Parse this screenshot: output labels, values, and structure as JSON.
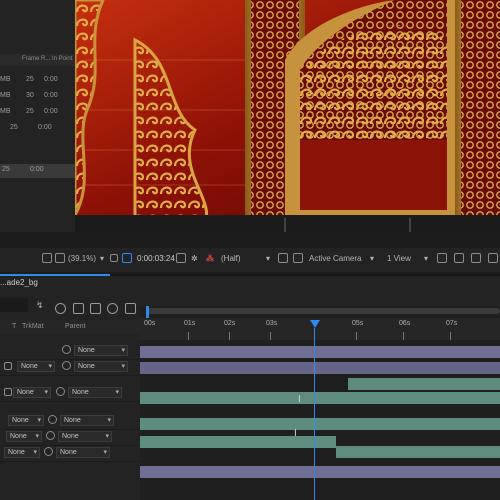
{
  "project": {
    "columns": {
      "frame_rate": "Frame R...",
      "in_point": "In Point"
    },
    "rows": [
      {
        "size": "MB",
        "frame_rate": "25",
        "in_point": "0:00"
      },
      {
        "size": "MB",
        "frame_rate": "30",
        "in_point": "0:00"
      },
      {
        "size": "MB",
        "frame_rate": "25",
        "in_point": "0:00"
      },
      {
        "size": "",
        "frame_rate": "25",
        "in_point": "0:00"
      },
      {
        "size": "",
        "frame_rate": "25",
        "in_point": "0:00"
      }
    ]
  },
  "viewer_toolbar": {
    "zoom": "(39.1%)",
    "timecode": "0:00:03:24",
    "resolution": "(Half)",
    "camera": "Active Camera",
    "view": "1 View"
  },
  "timeline": {
    "tab_name": "...ade2_bg",
    "columns": {
      "trkmat": "TrkMat",
      "parent": "Parent"
    },
    "ruler_ticks": [
      "00s",
      "01s",
      "02s",
      "03s",
      "05s",
      "06s",
      "07s"
    ],
    "current_time_marker": "3s",
    "layers": [
      {
        "mode": "",
        "parent": "None"
      },
      {
        "mode": "None",
        "parent": "None"
      },
      {
        "mode": "",
        "parent": ""
      },
      {
        "mode": "None",
        "parent": "None"
      },
      {
        "mode": "",
        "parent": ""
      },
      {
        "mode": "None",
        "parent": "None"
      },
      {
        "mode": "None",
        "parent": "None"
      },
      {
        "mode": "None",
        "parent": "None"
      }
    ]
  },
  "colors": {
    "accent": "#2d8ceb",
    "panel": "#232323",
    "track_purple": "#6f6f93",
    "track_teal": "#5f8c80",
    "gold": "#d7a03c",
    "red": "#8c1006"
  }
}
